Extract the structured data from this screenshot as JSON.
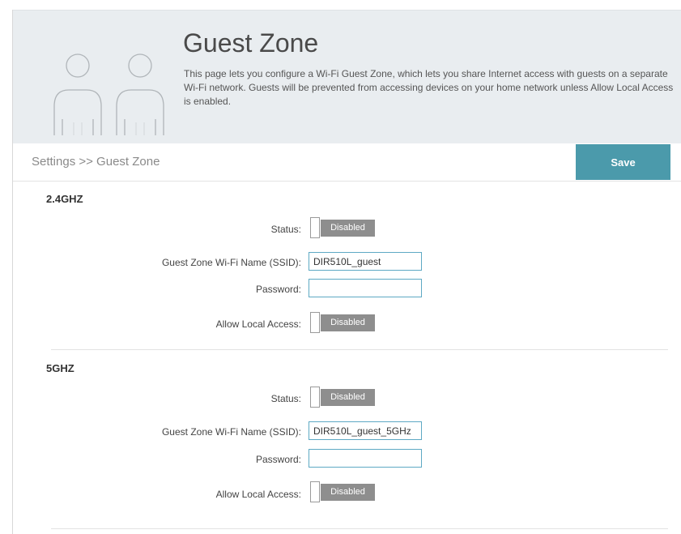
{
  "header": {
    "title": "Guest Zone",
    "description": "This page lets you configure a Wi-Fi Guest Zone, which lets you share Internet access with guests on a separate Wi-Fi network. Guests will be prevented from accessing devices on your home network unless Allow Local Access is enabled.",
    "icon": "guests-icon"
  },
  "breadcrumb": "Settings >> Guest Zone",
  "toolbar": {
    "save_label": "Save"
  },
  "colors": {
    "accent": "#4b9aab",
    "toggle_off": "#8e8e8e",
    "hero_bg": "#e9edf0",
    "input_border": "#5ea9c4"
  },
  "bands": [
    {
      "title": "2.4GHZ",
      "status_label": "Status:",
      "status_value": "Disabled",
      "ssid_label": "Guest Zone Wi-Fi Name (SSID):",
      "ssid_value": "DIR510L_guest",
      "password_label": "Password:",
      "password_value": "",
      "local_access_label": "Allow Local Access:",
      "local_access_value": "Disabled"
    },
    {
      "title": "5GHZ",
      "status_label": "Status:",
      "status_value": "Disabled",
      "ssid_label": "Guest Zone Wi-Fi Name (SSID):",
      "ssid_value": "DIR510L_guest_5GHz",
      "password_label": "Password:",
      "password_value": "",
      "local_access_label": "Allow Local Access:",
      "local_access_value": "Disabled"
    }
  ]
}
